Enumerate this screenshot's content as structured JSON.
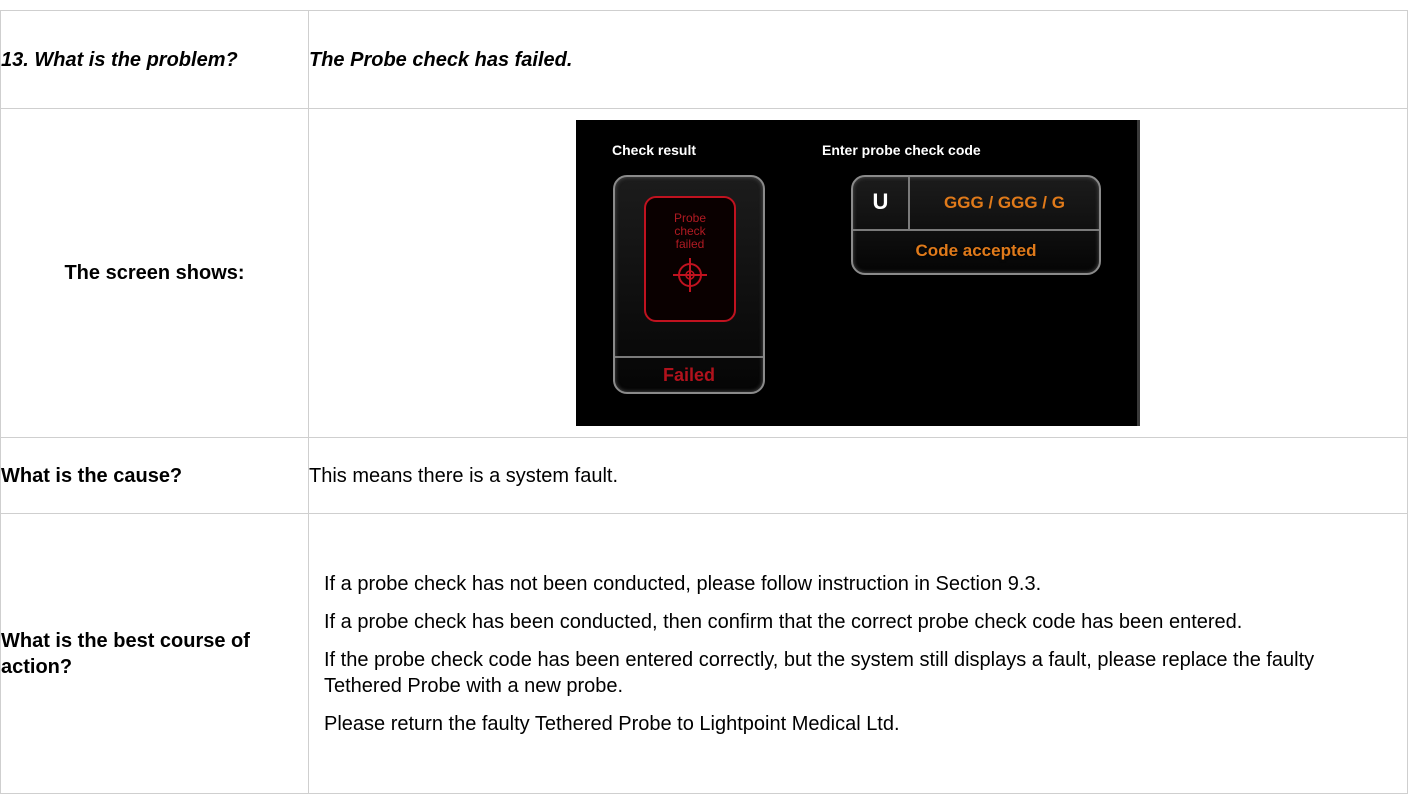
{
  "question": {
    "label": "13. What is the problem?",
    "answer": "The Probe check has failed."
  },
  "screen_row": {
    "label": "The screen shows:",
    "device": {
      "check_result_heading": "Check result",
      "card_text": [
        "Probe",
        "check",
        "failed"
      ],
      "status": "Failed",
      "code_heading": "Enter probe check code",
      "probe_symbol": "U",
      "code_value": "GGG / GGG / G",
      "code_status": "Code accepted",
      "colors": {
        "failed_red": "#c0121f",
        "code_orange": "#e07a1a"
      }
    }
  },
  "cause_row": {
    "label": "What is the cause?",
    "text": "This means there is a system fault."
  },
  "action_row": {
    "label": "What is the best course of action?",
    "paragraphs": [
      "If a probe check has not been conducted, please follow instruction in Section 9.3.",
      "If a probe check has been conducted, then confirm that the correct probe check code has been entered.",
      "If the probe check code has been entered correctly, but the system still displays a fault, please replace the faulty Tethered Probe with a new probe.",
      "Please return the faulty Tethered Probe to Lightpoint Medical Ltd."
    ]
  }
}
